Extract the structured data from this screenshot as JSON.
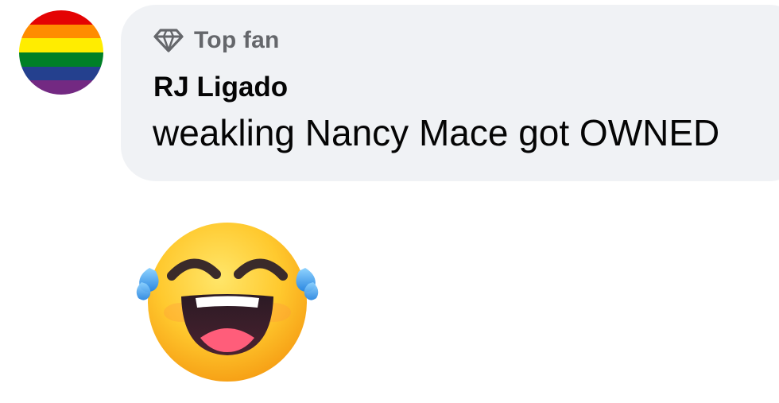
{
  "comment": {
    "badge": {
      "icon": "diamond-icon",
      "label": "Top fan"
    },
    "author": "RJ Ligado",
    "text": "weakling Nancy Mace got OWNED",
    "avatar": {
      "icon": "rainbow-flag-avatar",
      "colors": [
        "#e40303",
        "#ff8c00",
        "#ffed00",
        "#008026",
        "#24408e",
        "#732982"
      ]
    },
    "attachment": {
      "icon": "face-with-tears-of-joy-emoji"
    }
  },
  "colors": {
    "bubble_background": "#f0f2f5",
    "secondary_text": "#65676b",
    "primary_text": "#050505"
  }
}
